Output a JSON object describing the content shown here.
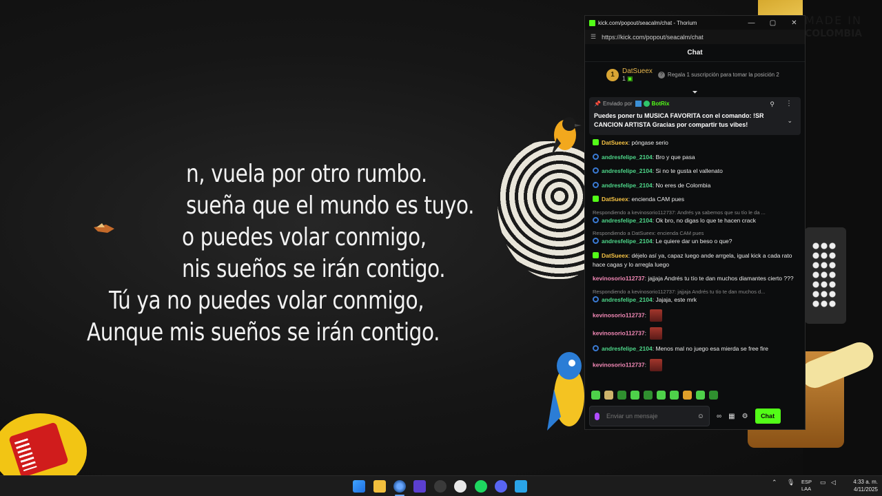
{
  "video": {
    "lyrics_visible": [
      "n, vuela por otro rumbo.",
      "sueña que el mundo es tuyo.",
      "o puedes volar conmigo,",
      "nis sueños se irán contigo."
    ],
    "lyrics_full": [
      "Tú ya no puedes volar conmigo,",
      "Aunque mis sueños se irán contigo."
    ],
    "background_text": {
      "made_in": "MADE IN",
      "country": "COLOMBIA"
    }
  },
  "window": {
    "title": "kick.com/popout/seacalm/chat - Thorium",
    "url": "https://kick.com/popout/seacalm/chat",
    "controls": {
      "minimize": "—",
      "maximize": "▢",
      "close": "✕"
    }
  },
  "chat": {
    "header": "Chat",
    "leaderboard": {
      "rank": "1",
      "name": "DatSueex",
      "count": "1",
      "gift_cta": "Regala 1 suscripción para tomar la posición 2"
    },
    "pinned": {
      "sent_by_label": "Enviado por",
      "sender": "BotRix",
      "message": "Puedes poner tu MUSICA FAVORITA con el comando: !SR CANCION ARTISTA Gracias por compartir tus vibes!"
    },
    "messages": [
      {
        "badge": "sub",
        "user": "DatSueex",
        "user_color": "yellow",
        "text": "póngase serio",
        "reply": ""
      },
      {
        "badge": "og",
        "user": "andresfelipe_2104",
        "user_color": "green",
        "text": "Bro y que pasa",
        "reply": ""
      },
      {
        "badge": "og",
        "user": "andresfelipe_2104",
        "user_color": "green",
        "text": "Si no te gusta el vallenato",
        "reply": ""
      },
      {
        "badge": "og",
        "user": "andresfelipe_2104",
        "user_color": "green",
        "text": "No eres de Colombia",
        "reply": ""
      },
      {
        "badge": "sub",
        "user": "DatSueex",
        "user_color": "yellow",
        "text": "encienda CAM pues",
        "reply": ""
      },
      {
        "badge": "og",
        "user": "andresfelipe_2104",
        "user_color": "green",
        "text": "Ok bro, no digas lo que te hacen crack",
        "reply": "Respondiendo a kevinosorio112737: Andrés ya sabemos que su tío le da ..."
      },
      {
        "badge": "og",
        "user": "andresfelipe_2104",
        "user_color": "green",
        "text": "Le quiere dar un beso o que?",
        "reply": "Respondiendo a DatSueex: encienda CAM pues"
      },
      {
        "badge": "sub",
        "user": "DatSueex",
        "user_color": "yellow",
        "text": "déjelo así ya, capaz luego ande arrgela, igual kick a cada rato hace cagas y lo arregla luego",
        "reply": ""
      },
      {
        "badge": "",
        "user": "kevinosorio112737",
        "user_color": "pink",
        "text": "jajjaja Andrés tu tío te dan muchos diamantes cierto ???",
        "reply": ""
      },
      {
        "badge": "og",
        "user": "andresfelipe_2104",
        "user_color": "green",
        "text": "Jajaja, este mrk",
        "reply": "Respondiendo a kevinosorio112737: jajjaja Andrés tu tío te dan muchos d..."
      },
      {
        "badge": "",
        "user": "kevinosorio112737",
        "user_color": "pink",
        "text": "",
        "emote": true,
        "reply": ""
      },
      {
        "badge": "",
        "user": "kevinosorio112737",
        "user_color": "pink",
        "text": "",
        "emote": true,
        "reply": ""
      },
      {
        "badge": "og",
        "user": "andresfelipe_2104",
        "user_color": "green",
        "text": "Menos mal no juego esa mierda se free fire",
        "reply": ""
      },
      {
        "badge": "",
        "user": "kevinosorio112737",
        "user_color": "pink",
        "text": "",
        "emote": true,
        "reply": ""
      }
    ],
    "emote_bar_count": 10,
    "input_placeholder": "Enviar un mensaje",
    "send_label": "Chat"
  },
  "taskbar": {
    "lang_top": "ESP",
    "lang_bottom": "LAA",
    "time": "4:33 a. m.",
    "date": "4/11/2025"
  },
  "colors": {
    "kick_green": "#53fc18",
    "chat_bg": "#0c0d0e",
    "user_yellow": "#f6c344",
    "user_green": "#4ed88a",
    "user_pink": "#f58ab8"
  }
}
